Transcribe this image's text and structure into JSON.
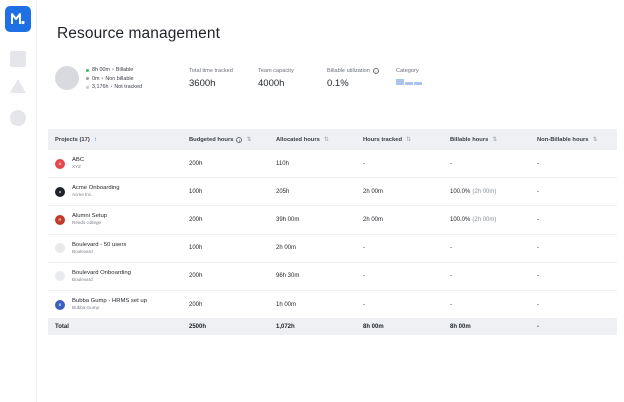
{
  "page": {
    "title": "Resource management"
  },
  "summary": {
    "legend": [
      {
        "amount": "8h 00m",
        "label": "Billable",
        "color": "#3fb86b"
      },
      {
        "amount": "0m",
        "label": "Non billable",
        "color": "#9aa0a8"
      },
      {
        "amount": "3,176h",
        "label": "Not tracked",
        "color": "#c7cbd1"
      }
    ],
    "total_time": {
      "label": "Total time tracked",
      "value": "3600h"
    },
    "team_capacity": {
      "label": "Team capacity",
      "value": "4000h"
    },
    "billable_utilization": {
      "label": "Billable utilization",
      "value": "0.1%",
      "icon": "info-icon"
    },
    "category": {
      "label": "Category"
    }
  },
  "table": {
    "headers": {
      "projects": "Projects (17)",
      "budgeted": "Budgeted hours",
      "allocated": "Allocated hours",
      "tracked": "Hours tracked",
      "billable": "Billable hours",
      "non_billable": "Non-Billable hours"
    },
    "rows": [
      {
        "name": "ABC",
        "client": "XYZ",
        "icon_color": "#e5484d",
        "icon_text": "A",
        "budgeted": "200h",
        "allocated": "110h",
        "tracked": "-",
        "billable": "-",
        "billable_extra": "",
        "non_billable": "-"
      },
      {
        "name": "Acme Onboarding",
        "client": "Acme Inc.",
        "icon_color": "#1f2328",
        "icon_text": "a",
        "budgeted": "100h",
        "allocated": "205h",
        "tracked": "2h 00m",
        "billable": "100.0%",
        "billable_extra": "(2h 00m)",
        "non_billable": "-"
      },
      {
        "name": "Alumni Setup",
        "client": "Reeds college",
        "icon_color": "#c0392b",
        "icon_text": "R",
        "budgeted": "200h",
        "allocated": "39h 00m",
        "tracked": "2h 00m",
        "billable": "100.0%",
        "billable_extra": "(2h 00m)",
        "non_billable": "-"
      },
      {
        "name": "Boulevard - 50 users",
        "client": "Boulevard",
        "icon_color": "#e9eaed",
        "icon_text": "",
        "budgeted": "100h",
        "allocated": "2h 00m",
        "tracked": "-",
        "billable": "-",
        "billable_extra": "",
        "non_billable": "-"
      },
      {
        "name": "Boulevard Onboarding",
        "client": "Boulevard",
        "icon_color": "#e9eaed",
        "icon_text": "",
        "budgeted": "200h",
        "allocated": "96h 30m",
        "tracked": "-",
        "billable": "-",
        "billable_extra": "",
        "non_billable": "-"
      },
      {
        "name": "Bubba Gump - HRMS set up",
        "client": "Bubba Gump",
        "icon_color": "#3a5fbf",
        "icon_text": "B",
        "budgeted": "200h",
        "allocated": "1h 00m",
        "tracked": "-",
        "billable": "-",
        "billable_extra": "",
        "non_billable": "-"
      }
    ],
    "footer": {
      "label": "Total",
      "budgeted": "2500h",
      "allocated": "1,072h",
      "tracked": "8h 00m",
      "billable": "8h 00m",
      "non_billable": "-"
    }
  }
}
